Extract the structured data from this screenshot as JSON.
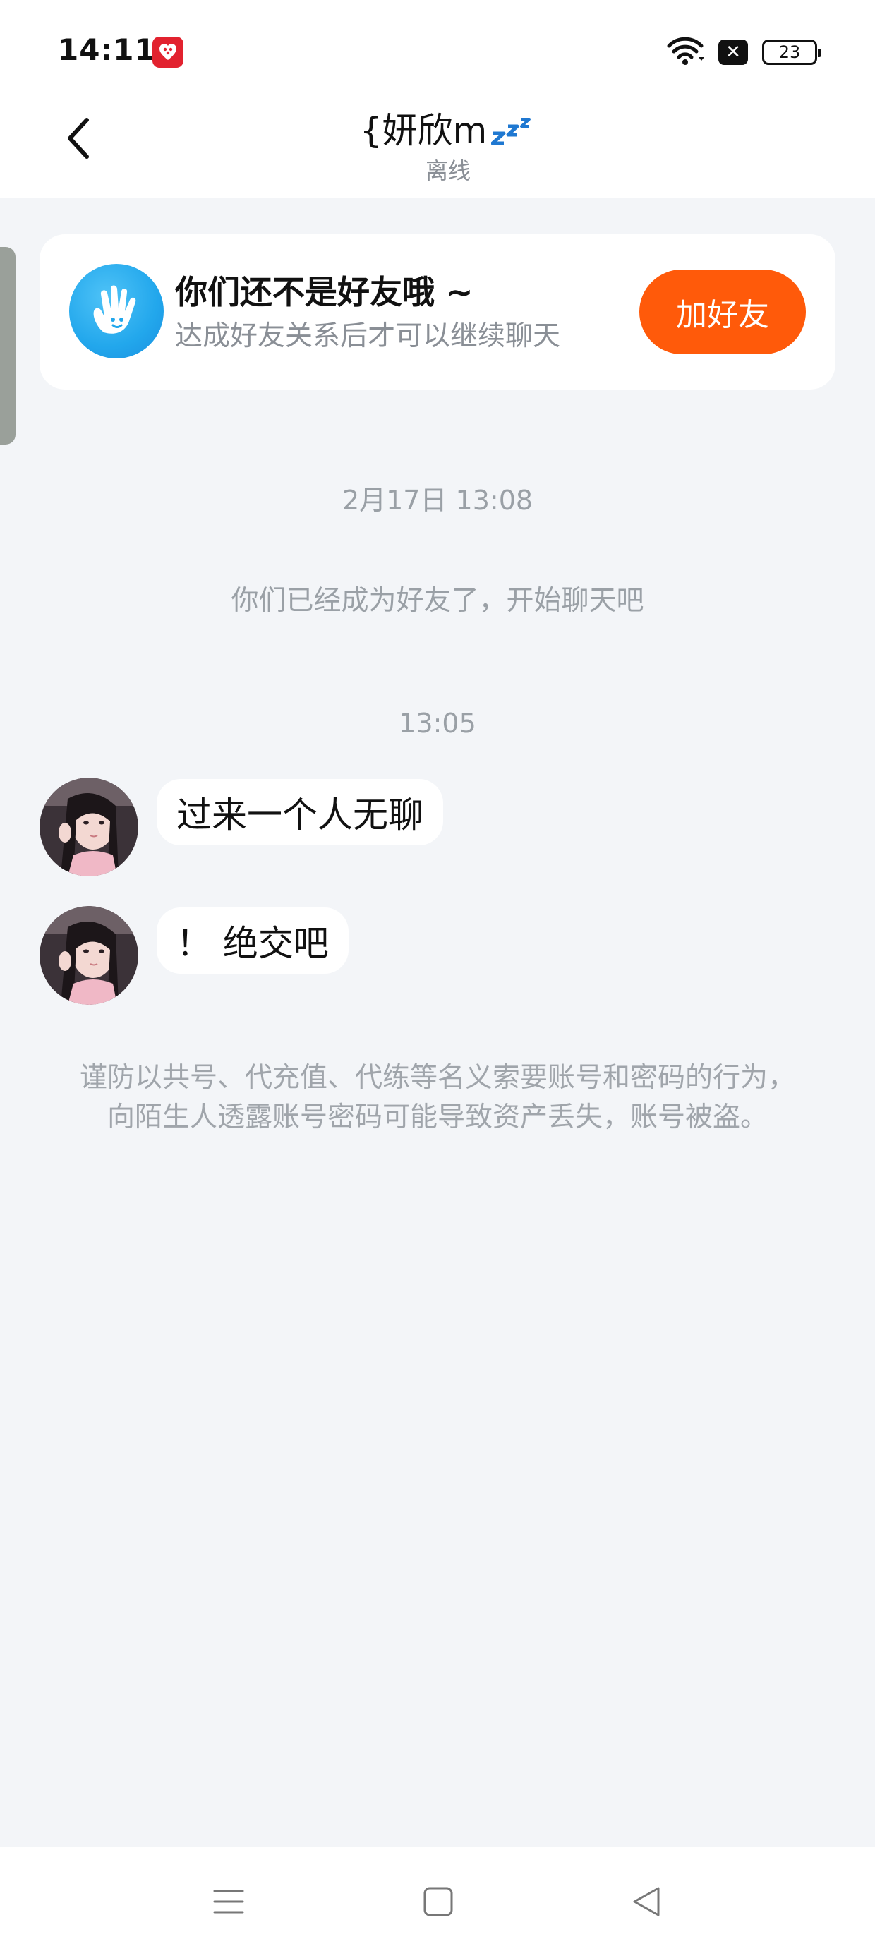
{
  "status_bar": {
    "time": "14:11",
    "battery_level": "23",
    "icons": [
      "app-notification-icon",
      "wifi-icon",
      "close-notification-icon",
      "battery-icon"
    ]
  },
  "header": {
    "title": "{妍欣m",
    "title_emoji_icon": "sleep-zzz-icon",
    "status": "离线",
    "back_icon": "chevron-left-icon"
  },
  "friend_card": {
    "title": "你们还不是好友哦 ~",
    "subtitle": "达成好友关系后才可以继续聊天",
    "button_label": "加好友",
    "icon": "hand-wave-icon",
    "button_color": "#ff5a0a"
  },
  "timeline": {
    "timestamp_1": "2月17日 13:08",
    "system_message": "你们已经成为好友了，开始聊天吧",
    "timestamp_2": "13:05"
  },
  "messages": [
    {
      "text": "过来一个人无聊"
    },
    {
      "text": "！ 绝交吧"
    }
  ],
  "notice": "谨防以共号、代充值、代练等名义索要账号和密码的行为，向陌生人透露账号密码可能导致资产丢失，账号被盗。",
  "nav_bar": {
    "icons": [
      "menu-icon",
      "home-square-icon",
      "back-triangle-icon"
    ]
  },
  "colors": {
    "background": "#f3f5f8",
    "accent_orange": "#ff5a0a",
    "hand_icon_blue": "#22a7ec"
  }
}
